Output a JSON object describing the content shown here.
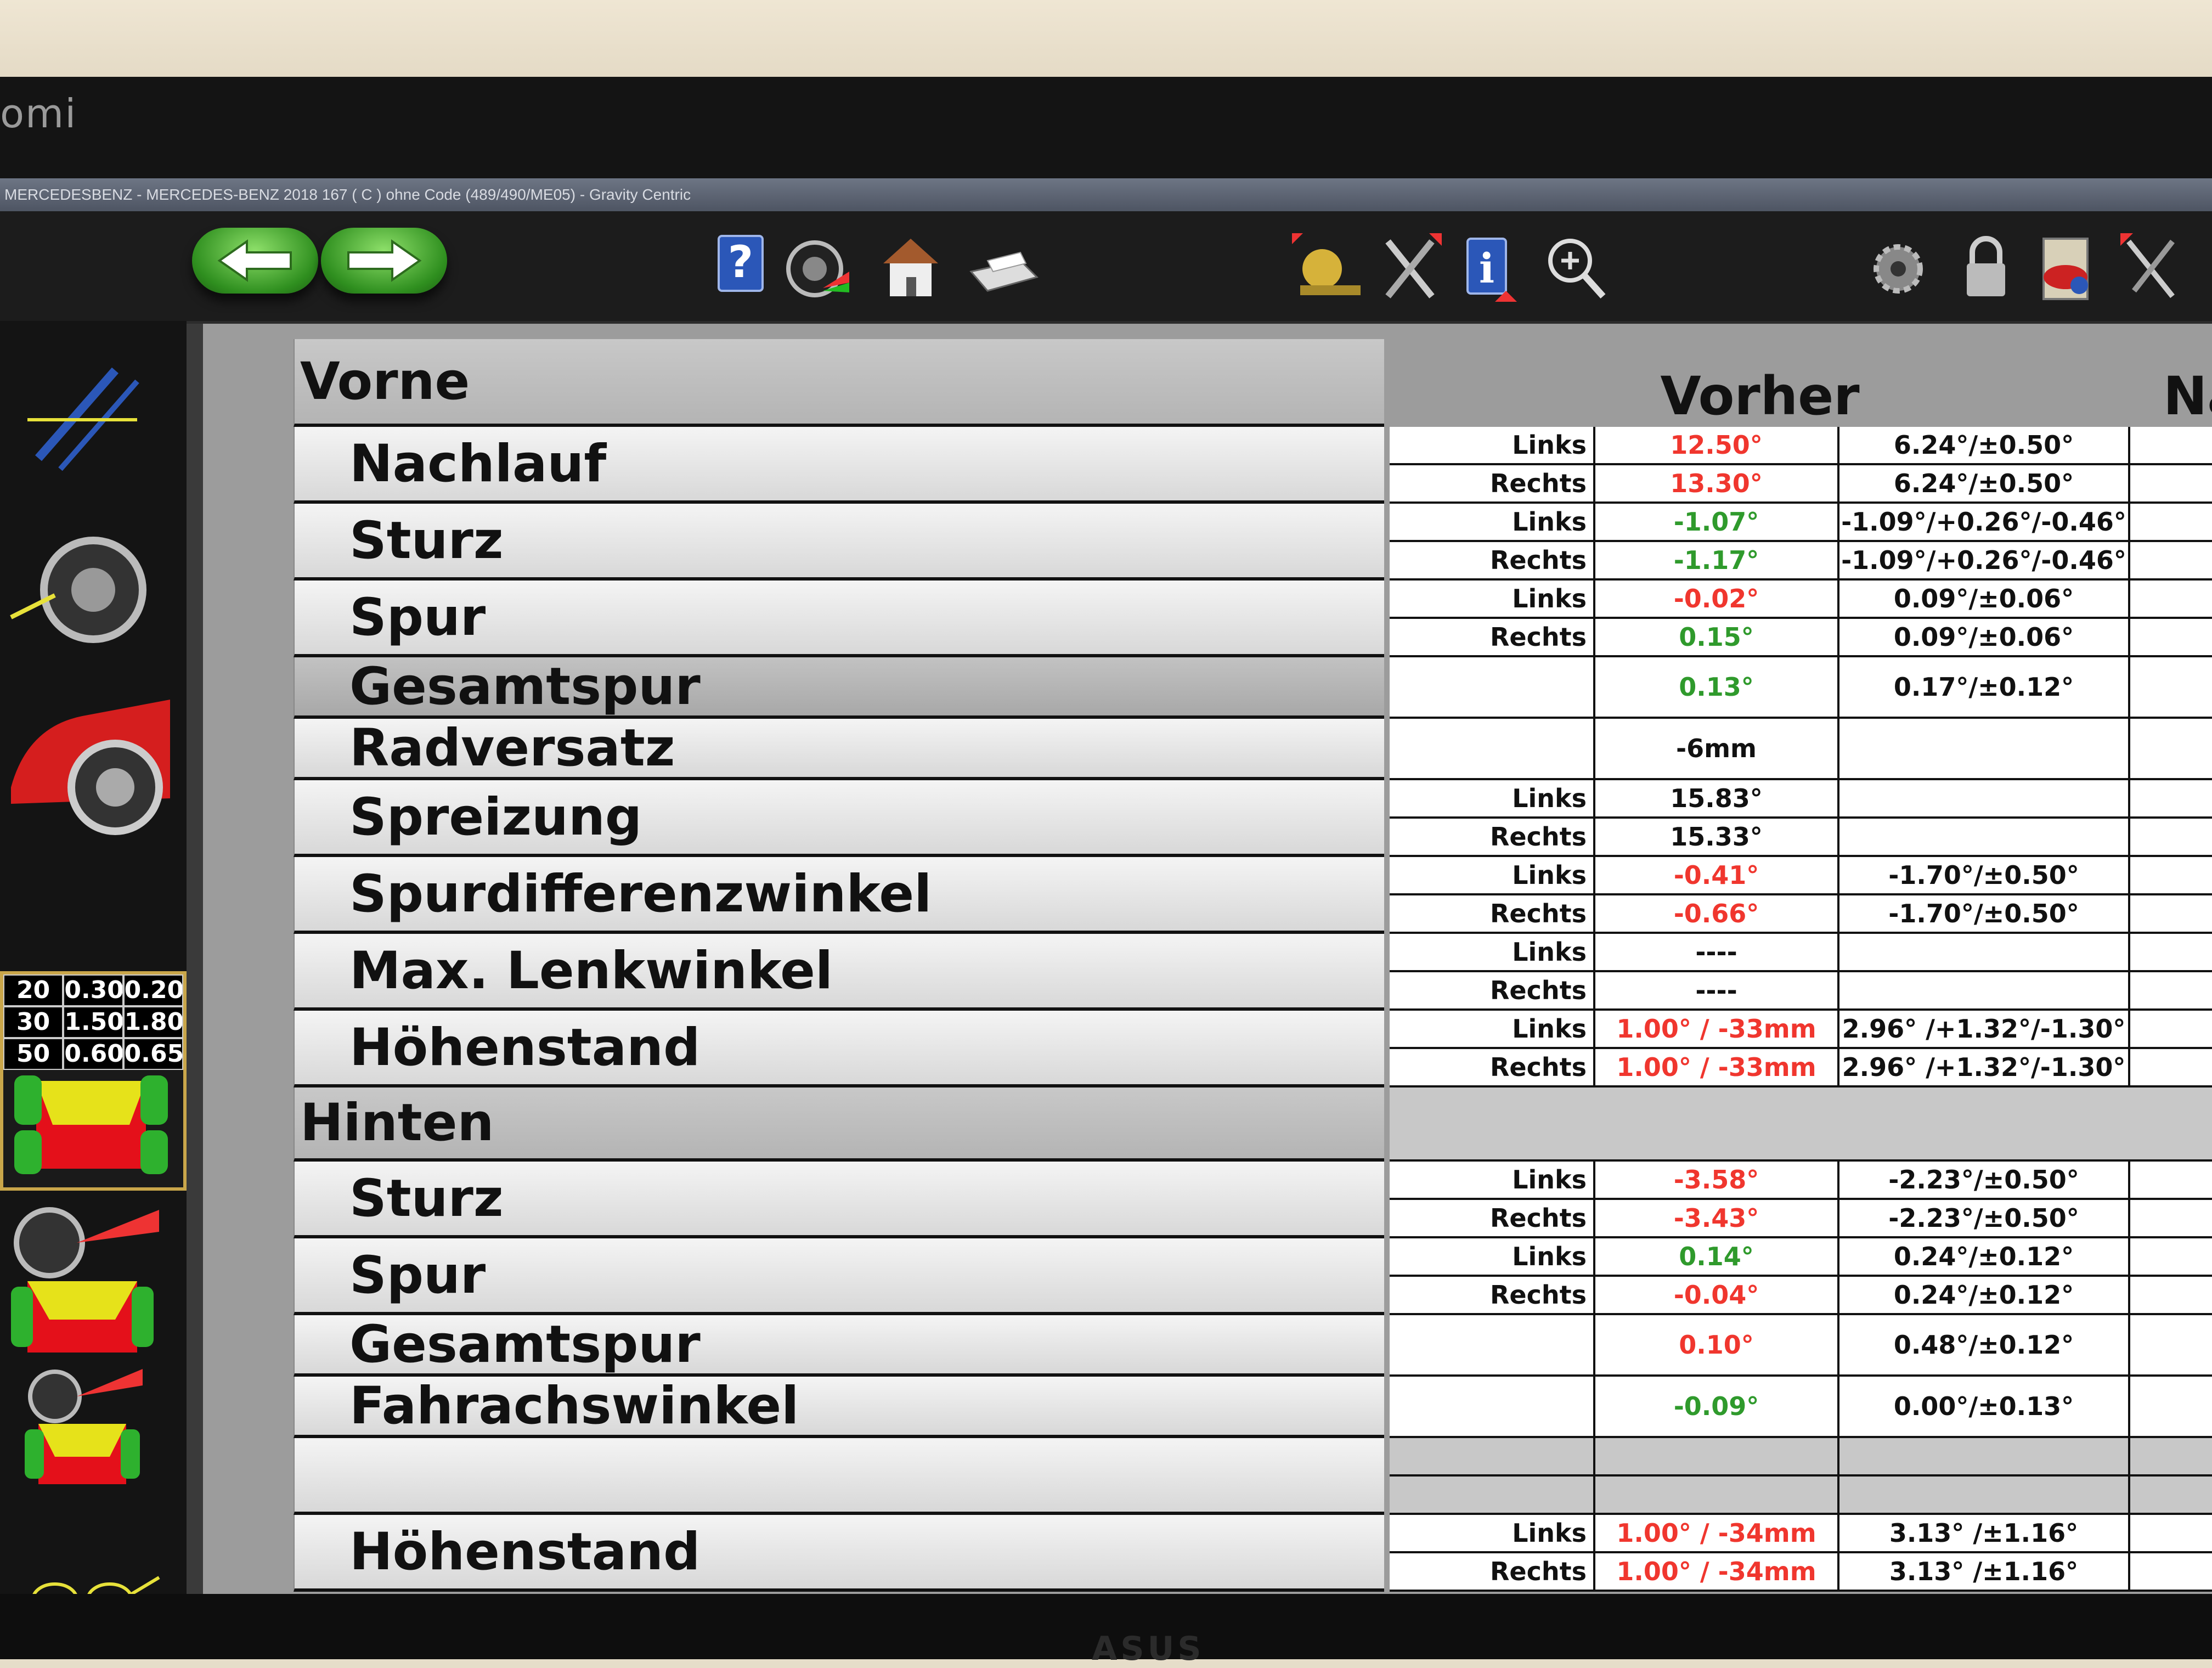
{
  "window": {
    "title": "MERCEDESBENZ - MERCEDES-BENZ 2018 167 ( C ) ohne Code (489/490/ME05)   - Gravity Centric"
  },
  "monitor": {
    "brand_top": "omi",
    "brand_bottom": "ASUS"
  },
  "toolbar": {
    "icons": [
      "back-arrow-icon",
      "forward-arrow-icon",
      "help-icon",
      "wheel-icon",
      "home-icon",
      "printer-icon",
      "adjust-icon",
      "tools-icon",
      "info-icon",
      "zoom-icon",
      "settings-gears-icon",
      "lock-icon",
      "clipboard-icon",
      "exit-icon"
    ]
  },
  "sidebar": {
    "mini_table": [
      [
        "20",
        "0.30",
        "0.20"
      ],
      [
        "30",
        "1.50",
        "1.80"
      ],
      [
        "50",
        "0.60",
        "0.65"
      ]
    ]
  },
  "table": {
    "col_before": "Vorher",
    "col_after": "Nac",
    "front_header": "Vorne",
    "rear_header": "Hinten",
    "front": [
      {
        "label": "Nachlauf",
        "rows": [
          {
            "side": "Links",
            "value": "12.50°",
            "color": "red",
            "spec": "6.24°/±0.50°"
          },
          {
            "side": "Rechts",
            "value": "13.30°",
            "color": "red",
            "spec": "6.24°/±0.50°"
          }
        ]
      },
      {
        "label": "Sturz",
        "rows": [
          {
            "side": "Links",
            "value": "-1.07°",
            "color": "green",
            "spec": "-1.09°/+0.26°/-0.46°"
          },
          {
            "side": "Rechts",
            "value": "-1.17°",
            "color": "green",
            "spec": "-1.09°/+0.26°/-0.46°"
          }
        ]
      },
      {
        "label": "Spur",
        "rows": [
          {
            "side": "Links",
            "value": "-0.02°",
            "color": "red",
            "spec": "0.09°/±0.06°"
          },
          {
            "side": "Rechts",
            "value": "0.15°",
            "color": "green",
            "spec": "0.09°/±0.06°"
          }
        ]
      },
      {
        "label": "Gesamtspur",
        "rows": [
          {
            "side": "",
            "value": "0.13°",
            "color": "green",
            "spec": "0.17°/±0.12°"
          }
        ]
      },
      {
        "label": "Radversatz",
        "rows": [
          {
            "side": "",
            "value": "-6mm",
            "color": "dark",
            "spec": ""
          }
        ]
      },
      {
        "label": "Spreizung",
        "rows": [
          {
            "side": "Links",
            "value": "15.83°",
            "color": "dark",
            "spec": ""
          },
          {
            "side": "Rechts",
            "value": "15.33°",
            "color": "dark",
            "spec": ""
          }
        ]
      },
      {
        "label": "Spurdifferenzwinkel",
        "rows": [
          {
            "side": "Links",
            "value": "-0.41°",
            "color": "red",
            "spec": "-1.70°/±0.50°"
          },
          {
            "side": "Rechts",
            "value": "-0.66°",
            "color": "red",
            "spec": "-1.70°/±0.50°"
          }
        ]
      },
      {
        "label": "Max. Lenkwinkel",
        "rows": [
          {
            "side": "Links",
            "value": "----",
            "color": "dark",
            "spec": ""
          },
          {
            "side": "Rechts",
            "value": "----",
            "color": "dark",
            "spec": ""
          }
        ]
      },
      {
        "label": "Höhenstand",
        "rows": [
          {
            "side": "Links",
            "value": "1.00° / -33mm",
            "color": "red",
            "spec": "2.96° /+1.32°/-1.30°"
          },
          {
            "side": "Rechts",
            "value": "1.00° / -33mm",
            "color": "red",
            "spec": "2.96° /+1.32°/-1.30°"
          }
        ]
      }
    ],
    "rear": [
      {
        "label": "Sturz",
        "rows": [
          {
            "side": "Links",
            "value": "-3.58°",
            "color": "red",
            "spec": "-2.23°/±0.50°"
          },
          {
            "side": "Rechts",
            "value": "-3.43°",
            "color": "red",
            "spec": "-2.23°/±0.50°"
          }
        ]
      },
      {
        "label": "Spur",
        "rows": [
          {
            "side": "Links",
            "value": "0.14°",
            "color": "green",
            "spec": "0.24°/±0.12°"
          },
          {
            "side": "Rechts",
            "value": "-0.04°",
            "color": "red",
            "spec": "0.24°/±0.12°"
          }
        ]
      },
      {
        "label": "Gesamtspur",
        "rows": [
          {
            "side": "",
            "value": "0.10°",
            "color": "red",
            "spec": "0.48°/±0.12°"
          }
        ]
      },
      {
        "label": "Fahrachswinkel",
        "rows": [
          {
            "side": "",
            "value": "-0.09°",
            "color": "green",
            "spec": "0.00°/±0.13°"
          }
        ]
      },
      {
        "label": "",
        "rows": [
          {
            "side": "",
            "value": "",
            "color": "dark",
            "spec": ""
          },
          {
            "side": "",
            "value": "",
            "color": "dark",
            "spec": ""
          }
        ]
      },
      {
        "label": "Höhenstand",
        "rows": [
          {
            "side": "Links",
            "value": "1.00° / -34mm",
            "color": "red",
            "spec": "3.13° /±1.16°"
          },
          {
            "side": "Rechts",
            "value": "1.00° / -34mm",
            "color": "red",
            "spec": "3.13° /±1.16°"
          }
        ]
      }
    ]
  },
  "colors": {
    "out_of_spec": "#f0362e",
    "in_spec": "#2f9a2c",
    "toolbar_green": "#3aa12a"
  }
}
